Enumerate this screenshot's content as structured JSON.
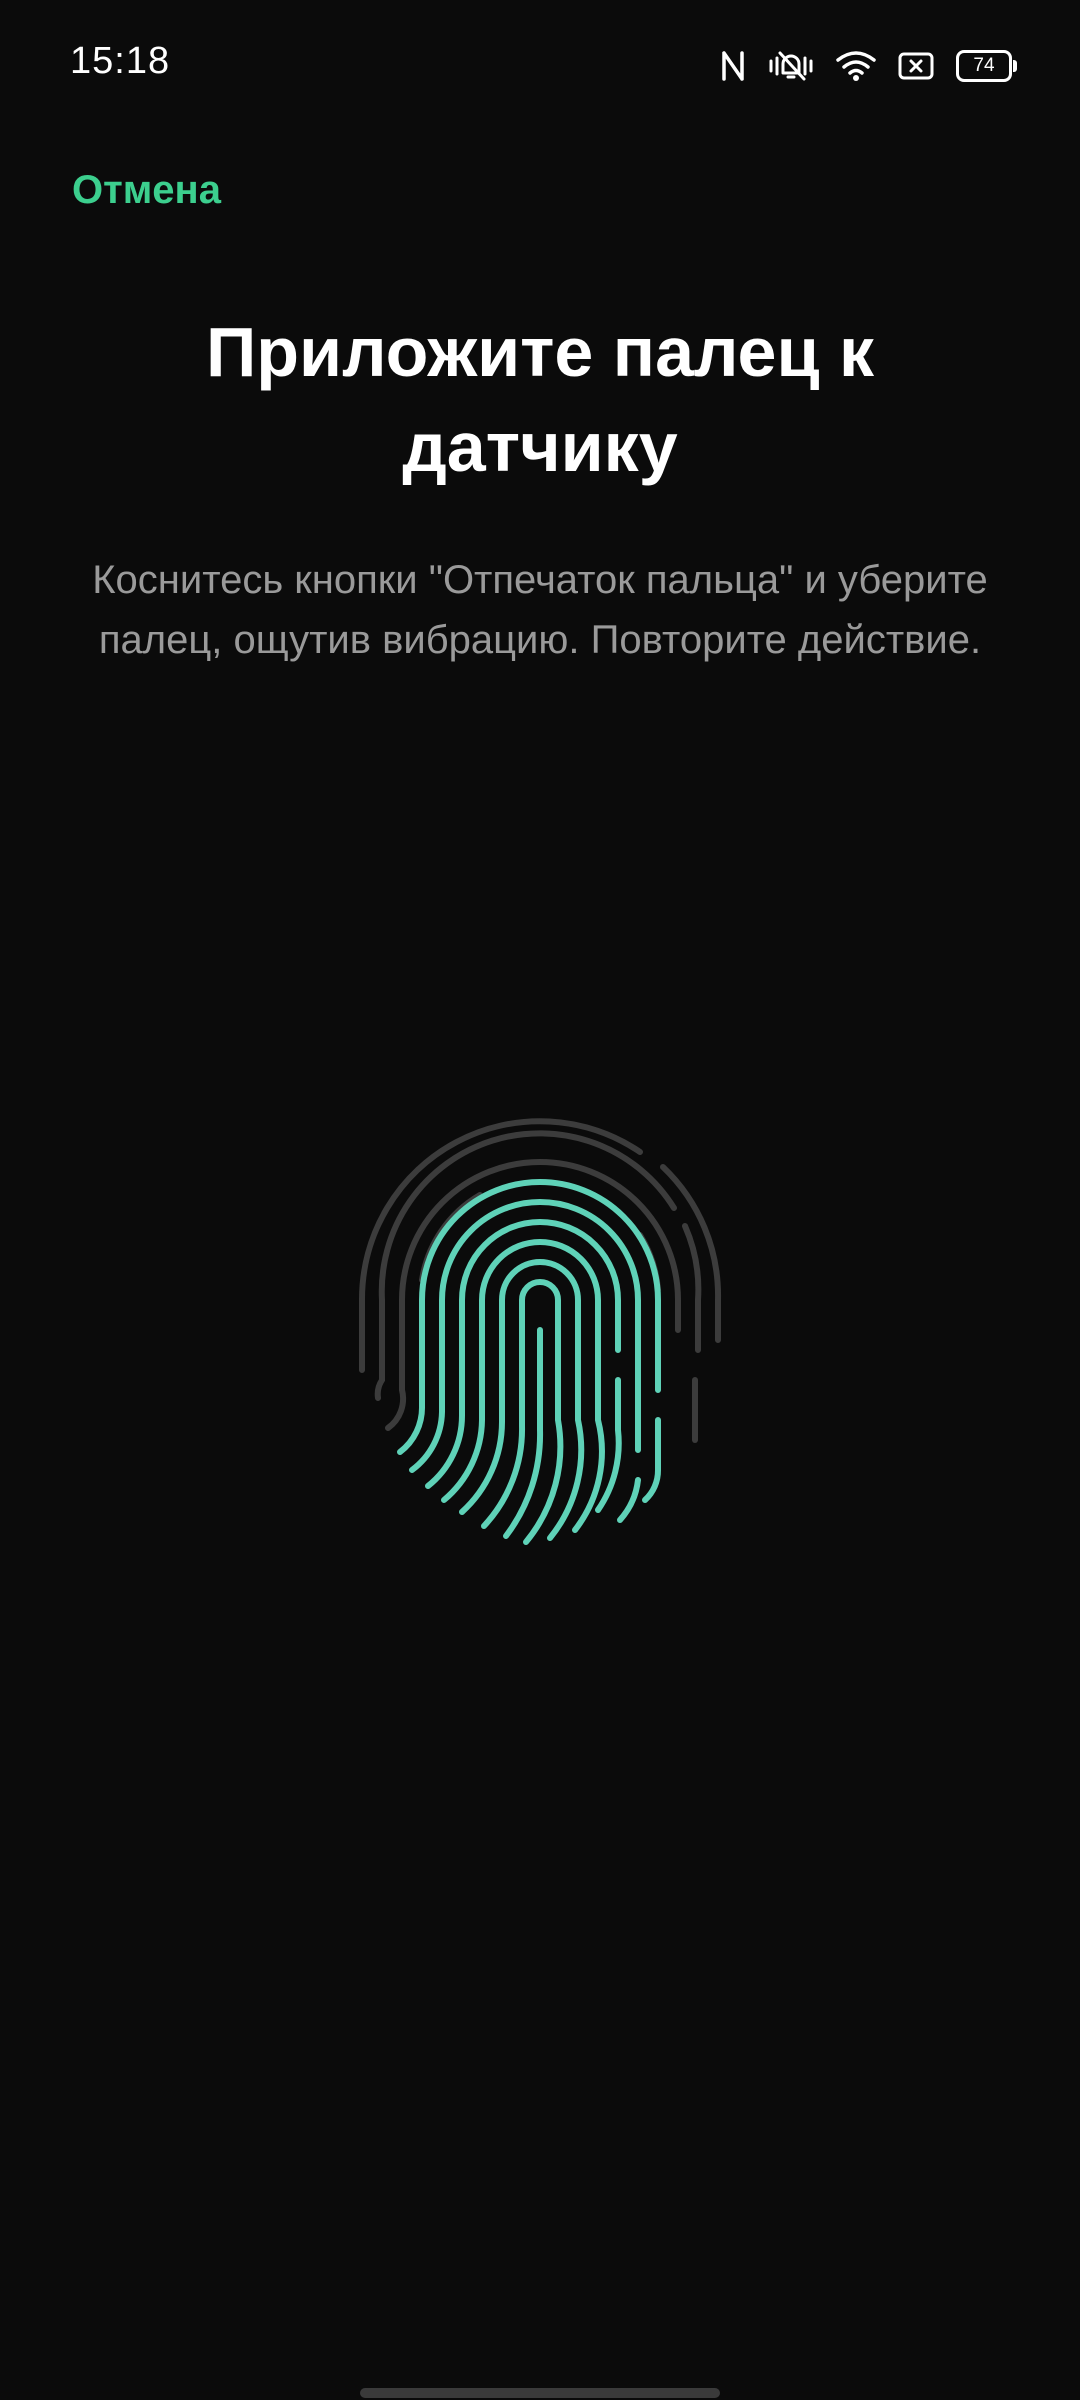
{
  "status_bar": {
    "time": "15:18",
    "battery_level": "74",
    "icons": [
      "nfc-icon",
      "vibrate-off-icon",
      "wifi-icon",
      "no-sim-icon",
      "battery-icon"
    ]
  },
  "header": {
    "cancel_label": "Отмена"
  },
  "main": {
    "title": "Приложите палец к датчику",
    "instruction": "Коснитесь кнопки \"Отпечаток пальца\" и уберите палец, ощутив вибрацию. Повторите действие."
  },
  "colors": {
    "background": "#0b0b0b",
    "accent": "#3ccf8e",
    "fingerprint_active": "#5fd2b8",
    "fingerprint_inactive": "#3c3c3c",
    "subtitle_text": "#9a9a9a"
  }
}
